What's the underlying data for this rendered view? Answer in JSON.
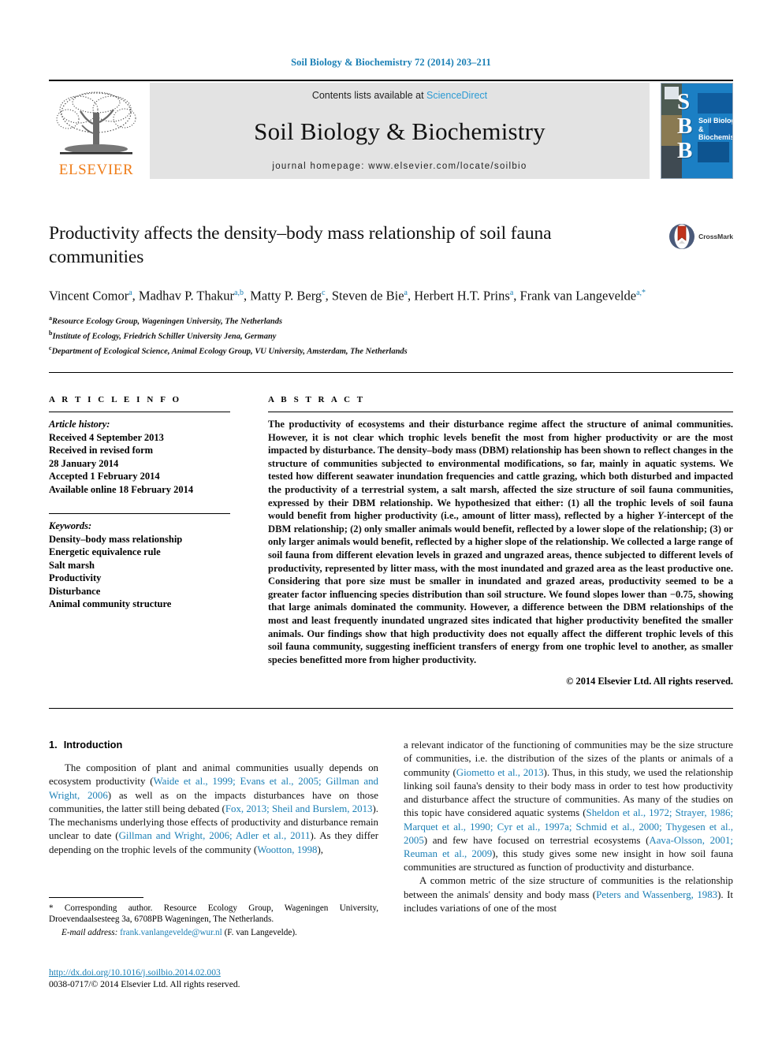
{
  "running_head": "Soil Biology & Biochemistry 72 (2014) 203–211",
  "masthead": {
    "publisher_logo_text": "ELSEVIER",
    "contents_prefix": "Contents lists available at ",
    "contents_link": "ScienceDirect",
    "journal_title": "Soil Biology & Biochemistry",
    "homepage": "journal homepage: www.elsevier.com/locate/soilbio",
    "cover": {
      "initials": "S\nB\nB",
      "name_line1": "Soil Biology &",
      "name_line2": "Biochemistry"
    }
  },
  "article": {
    "title": "Productivity affects the density–body mass relationship of soil fauna communities",
    "crossmark_label": "CrossMark",
    "authors_html": "Vincent Comor<sup>a</sup>, Madhav P. Thakur<sup>a,b</sup>, Matty P. Berg<sup>c</sup>, Steven de Bie<sup>a</sup>, Herbert H.T. Prins<sup>a</sup>, Frank van Langevelde<sup>a,*</sup>",
    "affiliations": [
      {
        "marker": "a",
        "text": "Resource Ecology Group, Wageningen University, The Netherlands"
      },
      {
        "marker": "b",
        "text": "Institute of Ecology, Friedrich Schiller University Jena, Germany"
      },
      {
        "marker": "c",
        "text": "Department of Ecological Science, Animal Ecology Group, VU University, Amsterdam, The Netherlands"
      }
    ]
  },
  "article_info": {
    "heading": "A R T I C L E  I N F O",
    "history_label": "Article history:",
    "history": [
      "Received 4 September 2013",
      "Received in revised form",
      "28 January 2014",
      "Accepted 1 February 2014",
      "Available online 18 February 2014"
    ],
    "keywords_label": "Keywords:",
    "keywords": [
      "Density–body mass relationship",
      "Energetic equivalence rule",
      "Salt marsh",
      "Productivity",
      "Disturbance",
      "Animal community structure"
    ]
  },
  "abstract": {
    "heading": "A B S T R A C T",
    "text_part1": "The productivity of ecosystems and their disturbance regime affect the structure of animal communities. However, it is not clear which trophic levels benefit the most from higher productivity or are the most impacted by disturbance. The density–body mass (DBM) relationship has been shown to reflect changes in the structure of communities subjected to environmental modifications, so far, mainly in aquatic systems. We tested how different seawater inundation frequencies and cattle grazing, which both disturbed and impacted the productivity of a terrestrial system, a salt marsh, affected the size structure of soil fauna communities, expressed by their DBM relationship. We hypothesized that either: (1) all the trophic levels of soil fauna would benefit from higher productivity (i.e., amount of litter mass), reflected by a higher ",
    "y_italic": "Y",
    "text_part2": "-intercept of the DBM relationship; (2) only smaller animals would benefit, reflected by a lower slope of the relationship; (3) or only larger animals would benefit, reflected by a higher slope of the relationship. We collected a large range of soil fauna from different elevation levels in grazed and ungrazed areas, thence subjected to different levels of productivity, represented by litter mass, with the most inundated and grazed area as the least productive one. Considering that pore size must be smaller in inundated and grazed areas, productivity seemed to be a greater factor influencing species distribution than soil structure. We found slopes lower than −0.75, showing that large animals dominated the community. However, a difference between the DBM relationships of the most and least frequently inundated ungrazed sites indicated that higher productivity benefited the smaller animals. Our findings show that high productivity does not equally affect the different trophic levels of this soil fauna community, suggesting inefficient transfers of energy from one trophic level to another, as smaller species benefitted more from higher productivity.",
    "copyright": "© 2014 Elsevier Ltd. All rights reserved."
  },
  "introduction": {
    "number": "1.",
    "heading": "Introduction",
    "left_para1_a": "The composition of plant and animal communities usually depends on ecosystem productivity (",
    "left_cite1": "Waide et al., 1999; Evans et al., 2005; Gillman and Wright, 2006",
    "left_para1_b": ") as well as on the impacts disturbances have on those communities, the latter still being debated (",
    "left_cite2": "Fox, 2013; Sheil and Burslem, 2013",
    "left_para1_c": "). The mechanisms underlying those effects of productivity and disturbance remain unclear to date (",
    "left_cite3": "Gillman and Wright, 2006; Adler et al., 2011",
    "left_para1_d": "). As they differ depending on the trophic levels of the community (",
    "left_cite4": "Wootton, 1998",
    "left_para1_e": "),",
    "right_para1_a": "a relevant indicator of the functioning of communities may be the size structure of communities, i.e. the distribution of the sizes of the plants or animals of a community (",
    "right_cite1": "Giometto et al., 2013",
    "right_para1_b": "). Thus, in this study, we used the relationship linking soil fauna's density to their body mass in order to test how productivity and disturbance affect the structure of communities. As many of the studies on this topic have considered aquatic systems (",
    "right_cite2": "Sheldon et al., 1972; Strayer, 1986; Marquet et al., 1990; Cyr et al., 1997a; Schmid et al., 2000; Thygesen et al., 2005",
    "right_para1_c": ") and few have focused on terrestrial ecosystems (",
    "right_cite3": "Aava-Olsson, 2001; Reuman et al., 2009",
    "right_para1_d": "), this study gives some new insight in how soil fauna communities are structured as function of productivity and disturbance.",
    "right_para2_a": "A common metric of the size structure of communities is the relationship between the animals' density and body mass (",
    "right_cite4": "Peters and Wassenberg, 1983",
    "right_para2_b": "). It includes variations of one of the most"
  },
  "footnote": {
    "corresponding": "* Corresponding author. Resource Ecology Group, Wageningen University, Droevendaalsesteeg 3a, 6708PB Wageningen, The Netherlands.",
    "email_label": "E-mail address:",
    "email": "frank.vanlangevelde@wur.nl",
    "email_suffix": " (F. van Langevelde).",
    "doi": "http://dx.doi.org/10.1016/j.soilbio.2014.02.003",
    "issn": "0038-0717/© 2014 Elsevier Ltd. All rights reserved."
  },
  "colors": {
    "link": "#1a7fb5",
    "sciencedirect": "#2b9ad3",
    "elsevier_orange": "#ef7d1a",
    "cover_blue": "#1b7fc4",
    "band_gray": "#e3e3e3"
  }
}
